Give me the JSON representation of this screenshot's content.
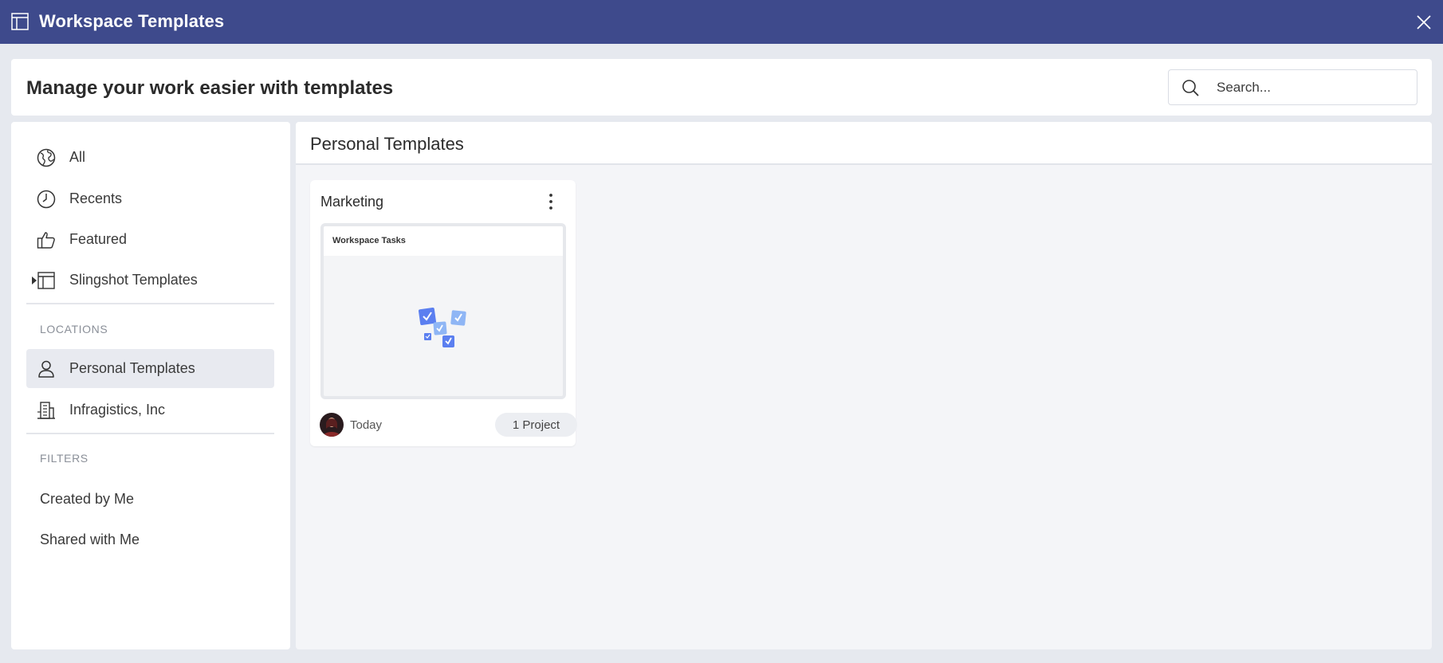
{
  "window": {
    "title": "Workspace Templates"
  },
  "header": {
    "heading": "Manage your work easier with templates"
  },
  "search": {
    "placeholder": "Search..."
  },
  "sidebar": {
    "items": [
      {
        "label": "All",
        "icon": "globe-icon"
      },
      {
        "label": "Recents",
        "icon": "clock-icon"
      },
      {
        "label": "Featured",
        "icon": "thumbs-up-icon"
      },
      {
        "label": "Slingshot Templates",
        "icon": "template-icon",
        "expandable": true
      }
    ],
    "locations_label": "LOCATIONS",
    "locations": [
      {
        "label": "Personal Templates",
        "icon": "person-icon",
        "active": true
      },
      {
        "label": "Infragistics, Inc",
        "icon": "building-icon"
      }
    ],
    "filters_label": "FILTERS",
    "filters": [
      {
        "label": "Created by Me"
      },
      {
        "label": "Shared with Me"
      }
    ]
  },
  "main": {
    "title": "Personal Templates",
    "cards": [
      {
        "title": "Marketing",
        "thumbnail_title": "Workspace Tasks",
        "date": "Today",
        "badge": "1 Project"
      }
    ]
  },
  "colors": {
    "titlebar": "#3e4a8c",
    "background": "#e6e9ef",
    "active_item": "#e8eaf0",
    "accent_task": "#5b7ff0",
    "accent_task_light": "#8fb6f5"
  }
}
